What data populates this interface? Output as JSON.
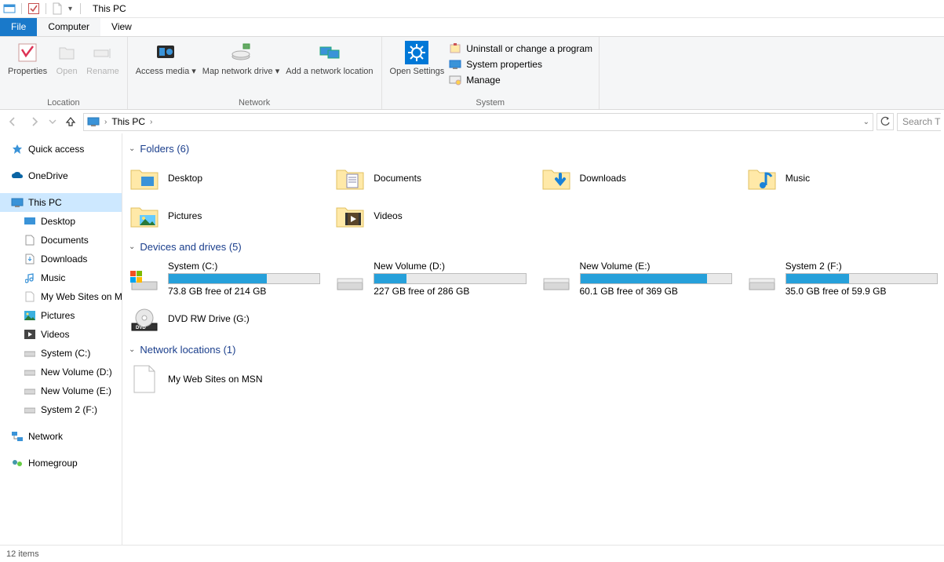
{
  "window": {
    "title": "This PC"
  },
  "tabs": {
    "file": "File",
    "computer": "Computer",
    "view": "View"
  },
  "ribbon": {
    "location": {
      "label": "Location",
      "properties": "Properties",
      "open": "Open",
      "rename": "Rename"
    },
    "network": {
      "label": "Network",
      "access_media": "Access media",
      "map_drive": "Map network drive",
      "add_location": "Add a network location"
    },
    "system": {
      "label": "System",
      "open_settings": "Open Settings",
      "uninstall": "Uninstall or change a program",
      "properties": "System properties",
      "manage": "Manage"
    }
  },
  "breadcrumb": {
    "item": "This PC",
    "search_placeholder": "Search This PC"
  },
  "nav": {
    "quick_access": "Quick access",
    "onedrive": "OneDrive",
    "this_pc": "This PC",
    "desktop": "Desktop",
    "documents": "Documents",
    "downloads": "Downloads",
    "music": "Music",
    "my_web_sites": "My Web Sites on MSN",
    "pictures": "Pictures",
    "videos": "Videos",
    "system_c": "System (C:)",
    "new_vol_d": "New Volume (D:)",
    "new_vol_e": "New Volume (E:)",
    "system2_f": "System 2 (F:)",
    "network": "Network",
    "homegroup": "Homegroup"
  },
  "sections": {
    "folders": "Folders (6)",
    "drives": "Devices and drives (5)",
    "netloc": "Network locations (1)"
  },
  "folders": {
    "desktop": "Desktop",
    "documents": "Documents",
    "downloads": "Downloads",
    "music": "Music",
    "pictures": "Pictures",
    "videos": "Videos"
  },
  "drives": {
    "c": {
      "name": "System (C:)",
      "sub": "73.8 GB free of 214 GB",
      "pct": 65
    },
    "d": {
      "name": "New Volume (D:)",
      "sub": "227 GB free of 286 GB",
      "pct": 21
    },
    "e": {
      "name": "New Volume (E:)",
      "sub": "60.1 GB free of 369 GB",
      "pct": 84
    },
    "f": {
      "name": "System 2 (F:)",
      "sub": "35.0 GB free of 59.9 GB",
      "pct": 42
    },
    "g": {
      "name": "DVD RW Drive (G:)"
    }
  },
  "netloc": {
    "mws": "My Web Sites on MSN"
  },
  "status": {
    "items": "12 items"
  }
}
